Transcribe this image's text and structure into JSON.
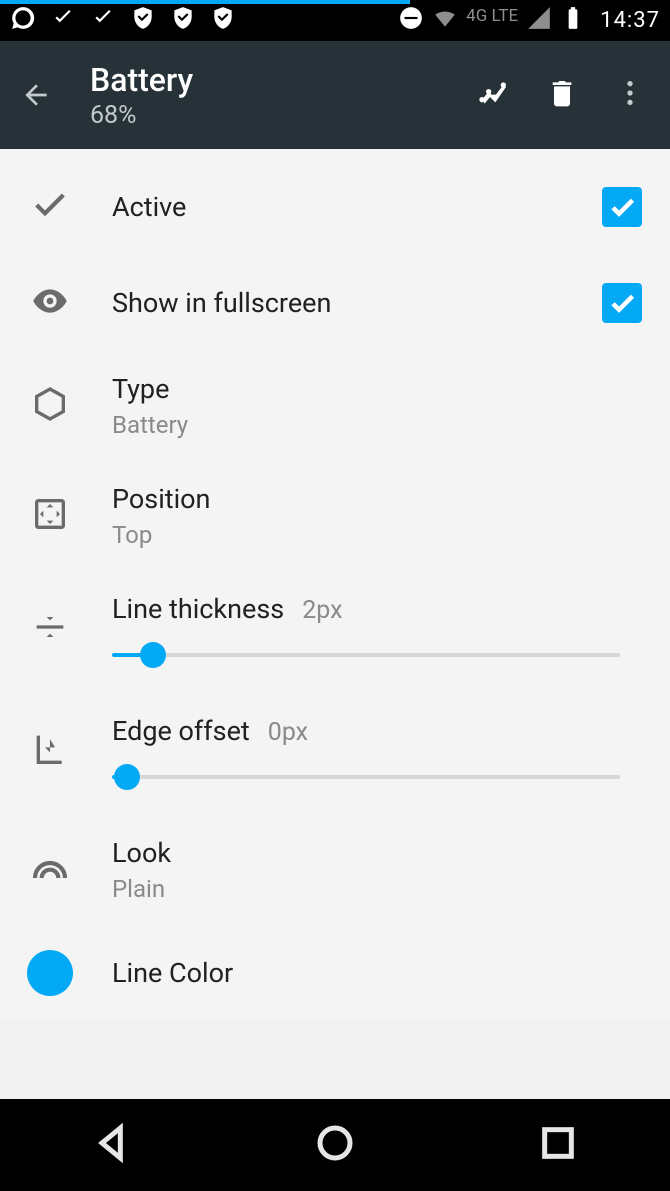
{
  "status": {
    "network_label": "4G LTE",
    "time": "14:37"
  },
  "appbar": {
    "title": "Battery",
    "subtitle": "68%"
  },
  "rows": {
    "active": {
      "label": "Active",
      "checked": true
    },
    "fullscreen": {
      "label": "Show in fullscreen",
      "checked": true
    },
    "type": {
      "label": "Type",
      "value": "Battery"
    },
    "position": {
      "label": "Position",
      "value": "Top"
    },
    "thickness": {
      "label": "Line thickness",
      "value": "2px",
      "pct": 8
    },
    "offset": {
      "label": "Edge offset",
      "value": "0px",
      "pct": 3
    },
    "look": {
      "label": "Look",
      "value": "Plain"
    },
    "linecolor": {
      "label": "Line Color",
      "color": "#03a9f4"
    }
  }
}
